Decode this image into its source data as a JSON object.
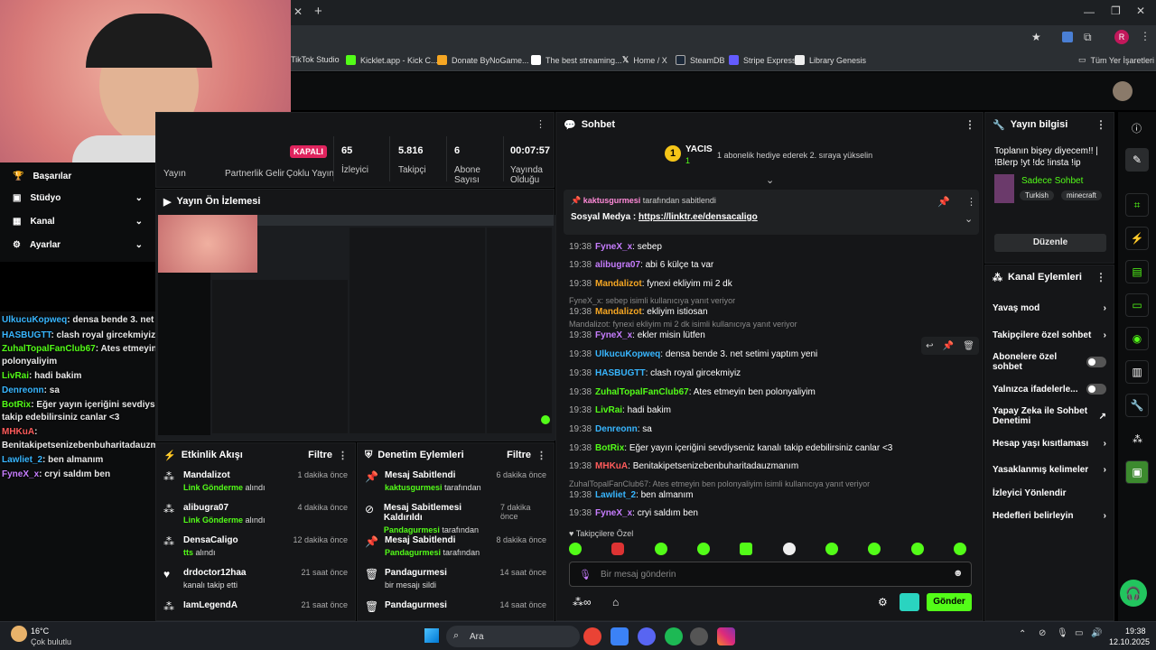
{
  "browser": {
    "tabs": [
      {
        "label": ""
      }
    ],
    "bookmarks": [
      "TikTok Studio",
      "Kicklet.app - Kick C...",
      "Donate ByNoGame...",
      "The best streaming...",
      "Home / X",
      "SteamDB",
      "Stripe Express",
      "Library Genesis"
    ],
    "other_bookmarks": "Tüm Yer İşaretleri",
    "profile_letter": "R"
  },
  "sidebar": {
    "items": [
      "Başarılar",
      "Stüdyo",
      "Kanal",
      "Ayarlar"
    ]
  },
  "stats": {
    "status": "KAPALI",
    "items": [
      {
        "value": "",
        "label": "Yayın"
      },
      {
        "value": "",
        "label": "Partnerlik Gelir"
      },
      {
        "value": "",
        "label": "Çoklu Yayın"
      },
      {
        "value": "65",
        "label": "İzleyici"
      },
      {
        "value": "5.816",
        "label": "Takipçi"
      },
      {
        "value": "6",
        "label": "Abone Sayısı"
      },
      {
        "value": "00:07:57",
        "label": "Yayında Olduğu"
      }
    ]
  },
  "preview": {
    "title": "Yayın Ön İzlemesi"
  },
  "overlay_chat": [
    {
      "name": "UlkucuKopweq",
      "text": ": densa bende 3. net setimi yaptım yeni",
      "color": "#38b6ff"
    },
    {
      "name": "HASBUGTT",
      "text": ": clash royal gircekmiyiz",
      "color": "#38b6ff"
    },
    {
      "name": "ZuhalTopalFanClub67",
      "text": ": Ates etmeyin ben",
      "color": "#53fc18"
    },
    {
      "name": "",
      "text": "polonyaliyim",
      "color": "#fff"
    },
    {
      "name": "LivRai",
      "text": ": hadi bakim",
      "color": "#53fc18"
    },
    {
      "name": "Denreonn",
      "text": ": sa",
      "color": "#38b6ff"
    },
    {
      "name": "BotRix",
      "text": ": Eğer yayın içeriğini sevdiyseniz kanalı",
      "color": "#53fc18"
    },
    {
      "name": "",
      "text": "takip edebilirsiniz canlar <3",
      "color": "#fff"
    },
    {
      "name": "MHKuA",
      "text": ":",
      "color": "#ff5b5b"
    },
    {
      "name": "",
      "text": "Benitakipetsenizebenbuharitadauzmanım",
      "color": "#fff"
    },
    {
      "name": "Lawliet_2",
      "text": ": ben almanım",
      "color": "#38b6ff"
    },
    {
      "name": "FyneX_x",
      "text": ": cryi saldım ben",
      "color": "#c77dff"
    }
  ],
  "activity": {
    "title": "Etkinlik Akışı",
    "filter": "Filtre",
    "items": [
      {
        "name": "Mandalizot",
        "action": "Link Gönderme",
        "suffix": "alındı",
        "time": "1 dakika önce"
      },
      {
        "name": "alibugra07",
        "action": "Link Gönderme",
        "suffix": "alındı",
        "time": "4 dakika önce"
      },
      {
        "name": "DensaCaligo",
        "action": "tts",
        "suffix": "alındı",
        "time": "12 dakika önce"
      },
      {
        "name": "drdoctor12haa",
        "action": "",
        "suffix": "kanalı takip etti",
        "time": "21 saat önce"
      },
      {
        "name": "IamLegendA",
        "action": "",
        "suffix": "",
        "time": "21 saat önce"
      }
    ]
  },
  "moderation": {
    "title": "Denetim Eylemleri",
    "filter": "Filtre",
    "items": [
      {
        "name": "Mesaj Sabitlendi",
        "action": "kaktusgurmesi",
        "suffix": "tarafından",
        "time": "6 dakika önce"
      },
      {
        "name": "Mesaj Sabitlemesi Kaldırıldı",
        "action": "Pandagurmesi",
        "suffix": "tarafından",
        "time": "7 dakika önce"
      },
      {
        "name": "Mesaj Sabitlendi",
        "action": "Pandagurmesi",
        "suffix": "tarafından",
        "time": "8 dakika önce"
      },
      {
        "name": "Pandagurmesi",
        "action": "",
        "suffix": "bir mesajı sildi",
        "time": "14 saat önce"
      },
      {
        "name": "Pandagurmesi",
        "action": "",
        "suffix": "",
        "time": "14 saat önce"
      }
    ]
  },
  "chat": {
    "title": "Sohbet",
    "top_gifter": "YACIS",
    "gift_count": "1",
    "gift_msg": "1 abonelik hediye ederek 2. sıraya yükselin",
    "pinned_by": "kaktusgurmesi",
    "pinned_suffix": "tarafından sabitlendi",
    "pinned_label": "Sosyal Medya :",
    "pinned_link": "https://linktr.ee/densacaligo",
    "messages": [
      {
        "time": "19:38",
        "name": "FyneX_x",
        "text": ": sebep",
        "color": "#c77dff"
      },
      {
        "time": "19:38",
        "name": "alibugra07",
        "text": ": abi 6 külçe ta var",
        "color": "#c77dff"
      },
      {
        "time": "19:38",
        "name": "Mandalizot",
        "text": ": fynexi ekliyim mi 2 dk",
        "color": "#f5a623"
      },
      {
        "time": "",
        "name": "",
        "text": "FyneX_x: sebep isimli kullanıcıya yanıt veriyor",
        "color": "#888"
      },
      {
        "time": "19:38",
        "name": "Mandalizot",
        "text": ": ekliyim istiosan",
        "color": "#f5a623"
      },
      {
        "time": "",
        "name": "",
        "text": "Mandalizot: fynexi ekliyim mi 2 dk isimli kullanıcıya yanıt veriyor",
        "color": "#888"
      },
      {
        "time": "19:38",
        "name": "FyneX_x",
        "text": ": ekler misin lütfen",
        "color": "#c77dff"
      },
      {
        "time": "19:38",
        "name": "UlkucuKopweq",
        "text": ": densa bende 3. net setimi yaptım yeni",
        "color": "#38b6ff"
      },
      {
        "time": "19:38",
        "name": "HASBUGTT",
        "text": ": clash royal gircekmiyiz",
        "color": "#38b6ff"
      },
      {
        "time": "19:38",
        "name": "ZuhalTopalFanClub67",
        "text": ": Ates etmeyin ben polonyaliyim",
        "color": "#53fc18"
      },
      {
        "time": "19:38",
        "name": "LivRai",
        "text": ": hadi bakim",
        "color": "#53fc18"
      },
      {
        "time": "19:38",
        "name": "Denreonn",
        "text": ": sa",
        "color": "#38b6ff"
      },
      {
        "time": "19:38",
        "name": "BotRix",
        "text": ": Eğer yayın içeriğini sevdiyseniz kanalı takip edebilirsiniz canlar <3",
        "color": "#53fc18"
      },
      {
        "time": "19:38",
        "name": "MHKuA",
        "text": ": Benitakipetsenizebenbuharitadauzmanım",
        "color": "#ff5b5b"
      },
      {
        "time": "",
        "name": "",
        "text": "ZuhalTopalFanClub67: Ates etmeyin ben polonyaliyim isimli kullanıcıya yanıt veriyor",
        "color": "#888"
      },
      {
        "time": "19:38",
        "name": "Lawliet_2",
        "text": ": ben almanım",
        "color": "#38b6ff"
      },
      {
        "time": "19:38",
        "name": "FyneX_x",
        "text": ": cryi saldım ben",
        "color": "#c77dff"
      }
    ],
    "followers_only": "Takipçilere Özel",
    "input_placeholder": "Bir mesaj gönderin",
    "send": "Gönder"
  },
  "stream_info": {
    "title": "Yayın bilgisi",
    "stream_title": "Toplanın bişey diyecem!! | !Blerp !yt !dc !insta !ip",
    "category": "Sadece Sohbet",
    "tags": [
      "Turkish",
      "minecraft"
    ],
    "edit": "Düzenle"
  },
  "channel_actions": {
    "title": "Kanal Eylemleri",
    "items": [
      "Yavaş mod",
      "Takipçilere özel sohbet",
      "Abonelere özel sohbet",
      "Yalnızca ifadelerle...",
      "Yapay Zeka ile Sohbet Denetimi",
      "Hesap yaşı kısıtlaması",
      "Yasaklanmış kelimeler",
      "İzleyici Yönlendir",
      "Hedefleri belirleyin"
    ]
  },
  "taskbar": {
    "temp": "16°C",
    "weather": "Çok bulutlu",
    "search": "Ara",
    "time": "19:38",
    "date": "12.10.2025"
  },
  "colors": {
    "accent": "#53fc18",
    "panel": "#151618"
  }
}
